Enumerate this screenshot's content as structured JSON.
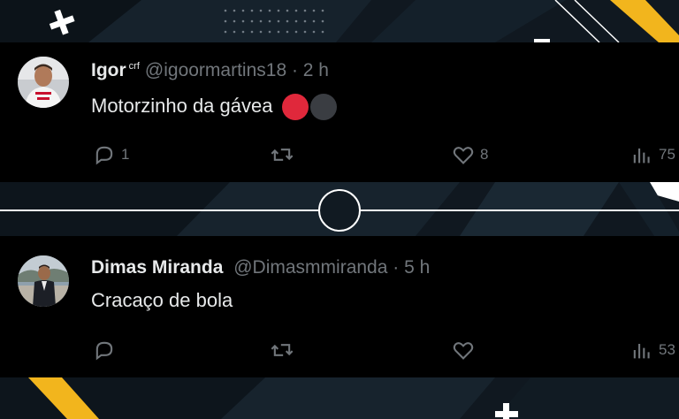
{
  "tweets": [
    {
      "name": "Igor",
      "badge": "crf",
      "handle": "@igoormartins18",
      "time": "· 2 h",
      "text": "Motorzinho da gávea",
      "replies": "1",
      "retweets": "",
      "likes": "8",
      "views": "75"
    },
    {
      "name": "Dimas Miranda",
      "handle": "@Dimasmmiranda",
      "time": "· 5 h",
      "text": "Cracaço de bola",
      "replies": "",
      "retweets": "",
      "likes": "",
      "views": "53"
    }
  ],
  "colors": {
    "background": "#101820",
    "card": "#000000",
    "accent_yellow": "#f2b51d",
    "text_primary": "#e7e9ea",
    "text_secondary": "#71767b",
    "emoji_red": "#e0283b"
  },
  "icons": [
    "reply-icon",
    "retweet-icon",
    "like-icon",
    "views-icon",
    "plus-icon",
    "ring-icon"
  ]
}
